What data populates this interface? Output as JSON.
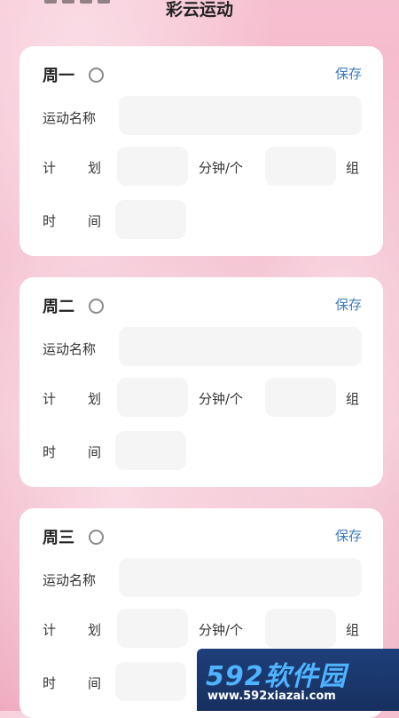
{
  "header": {
    "title": "彩云运动"
  },
  "labels": {
    "name": "运动名称",
    "plan_1": "计",
    "plan_2": "划",
    "time_1": "时",
    "time_2": "间",
    "unit_minutes": "分钟/个",
    "unit_sets": "组",
    "save": "保存"
  },
  "days": [
    {
      "label": "周一",
      "selected": false,
      "exercise_name": "",
      "plan_value": "",
      "sets_value": "",
      "time_value": ""
    },
    {
      "label": "周二",
      "selected": false,
      "exercise_name": "",
      "plan_value": "",
      "sets_value": "",
      "time_value": ""
    },
    {
      "label": "周三",
      "selected": false,
      "exercise_name": "",
      "plan_value": "",
      "sets_value": "",
      "time_value": ""
    }
  ],
  "watermark": {
    "brand": "592软件园",
    "url": "www.592xiazai.com"
  },
  "colors": {
    "accent": "#3c7bbf",
    "card": "#ffffff",
    "field": "#f5f5f5"
  }
}
